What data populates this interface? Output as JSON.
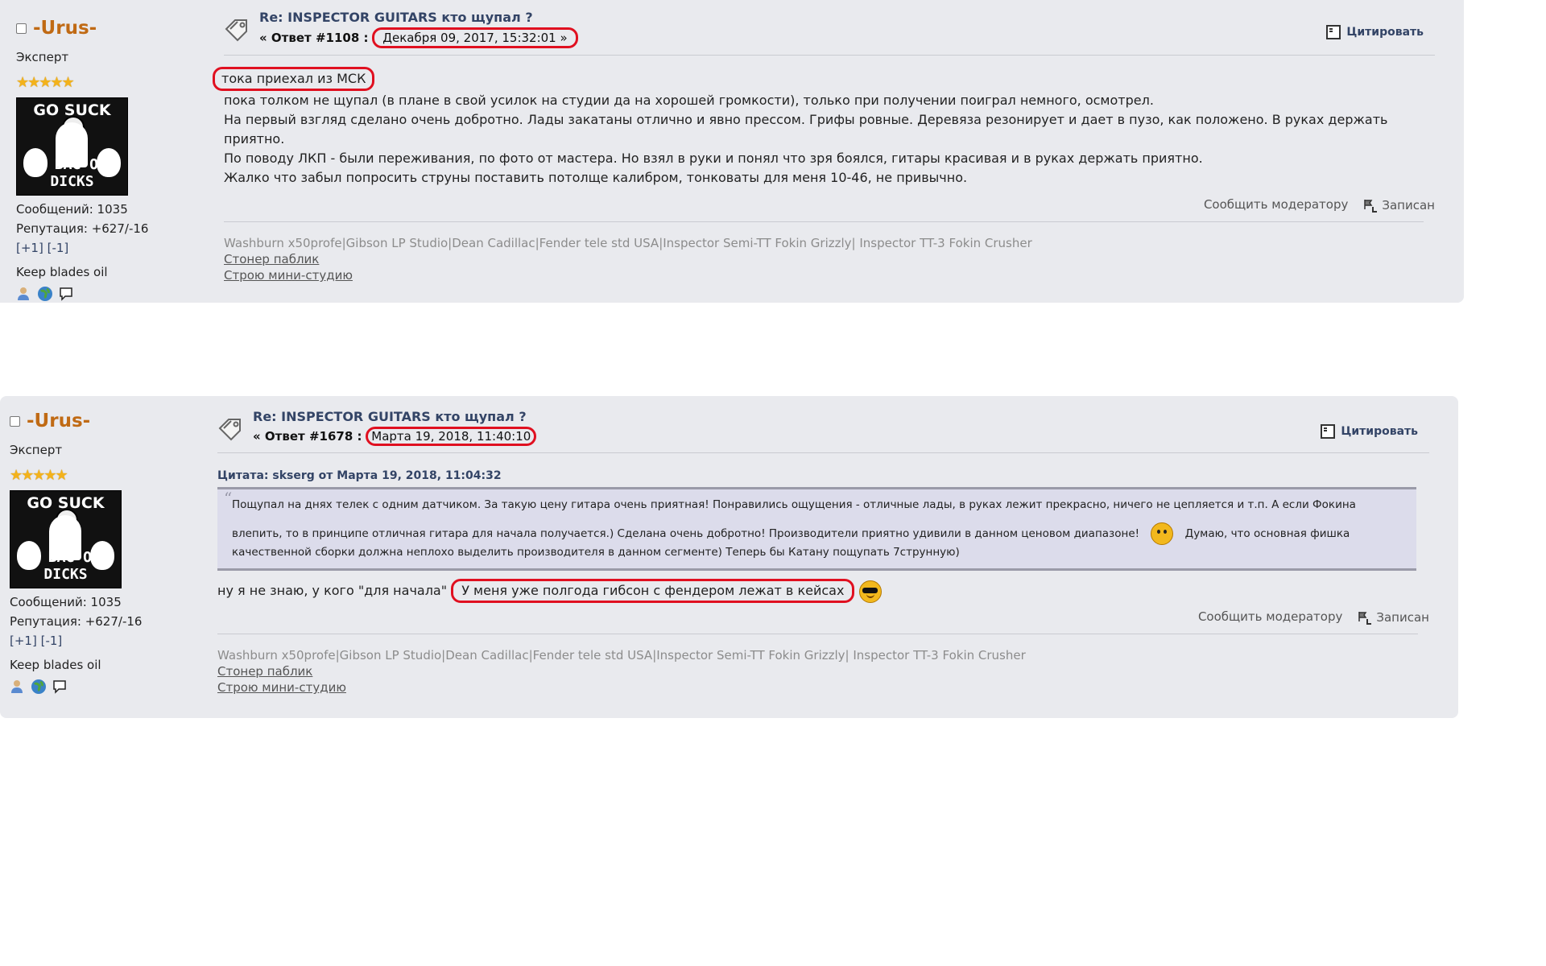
{
  "posts": [
    {
      "poster": {
        "name": "-Urus-",
        "title": "Эксперт",
        "stars": "★★★★★",
        "avatar_top": "GO SUCK",
        "avatar_bottom": "A BAG OF DICKS",
        "posts_count": "Сообщений: 1035",
        "reputation": "Репутация: +627/-16",
        "karma_plus": "[+1]",
        "karma_minus": "[-1]",
        "blurb": "Keep blades oil"
      },
      "subject": "Re: INSPECTOR GUITARS кто щупал ?",
      "meta_prefix": "« Ответ #1108 :",
      "date": "Декабря 09, 2017, 15:32:01 »",
      "quote_label": "Цитировать",
      "lines": [
        "тока приехал из МСК",
        "пока толком не щупал (в плане в свой усилок на студии да на хорошей громкости), только при получении поиграл немного, осмотрел.",
        "На первый взгляд сделано очень добротно. Лады закатаны отлично и явно прессом. Грифы ровные. Деревяза резонирует и дает в пузо, как положено. В руках держать приятно.",
        "По поводу ЛКП - были переживания, по фото от мастера. Но взял в руки и понял что зря боялся, гитары красивая и в руках держать приятно.",
        "Жалко что забыл попросить струны поставить потолще калибром, тонковаты для меня 10-46, не привычно."
      ],
      "report": "Сообщить модератору",
      "logged": "Записан",
      "signature": {
        "gear": "Washburn x50profe|Gibson LP Studio|Dean Cadillac|Fender tele std USA|Inspector Semi-TT Fokin Grizzly| Inspector TT-3 Fokin Crusher",
        "link1": "Стонер паблик",
        "link2": "Строю мини-студию"
      }
    },
    {
      "poster": {
        "name": "-Urus-",
        "title": "Эксперт",
        "stars": "★★★★★",
        "avatar_top": "GO SUCK",
        "avatar_bottom": "A BAG OF DICKS",
        "posts_count": "Сообщений: 1035",
        "reputation": "Репутация: +627/-16",
        "karma_plus": "[+1]",
        "karma_minus": "[-1]",
        "blurb": "Keep blades oil"
      },
      "subject": "Re: INSPECTOR GUITARS кто щупал ?",
      "meta_prefix": "« Ответ #1678 :",
      "date": "Марта 19, 2018, 11:40:10",
      "quote_label": "Цитировать",
      "quote": {
        "header": "Цитата: skserg от Марта 19, 2018, 11:04:32",
        "line1": "Пощупал на днях телек с одним датчиком. За такую цену гитара очень приятная! Понравились ощущения - отличные лады, в руках лежит прекрасно, ничего не цепляется и т.п. А если Фокина",
        "line2": "влепить, то в принципе отличная гитара для начала получается.) Сделана очень добротно! Производители приятно удивили в данном ценовом диапазоне!",
        "line2b": "Думаю, что основная фишка",
        "line3": "качественной сборки должна неплохо выделить производителя в данном сегменте) Теперь бы Катану пощупать 7струнную)"
      },
      "reply_prefix": "ну я не знаю, у кого \"для начала\"",
      "reply_highlight": "У меня уже полгода гибсон с фендером лежат в кейсах",
      "report": "Сообщить модератору",
      "logged": "Записан",
      "signature": {
        "gear": "Washburn x50profe|Gibson LP Studio|Dean Cadillac|Fender tele std USA|Inspector Semi-TT Fokin Grizzly| Inspector TT-3 Fokin Crusher",
        "link1": "Стонер паблик",
        "link2": "Строю мини-студию"
      }
    }
  ]
}
